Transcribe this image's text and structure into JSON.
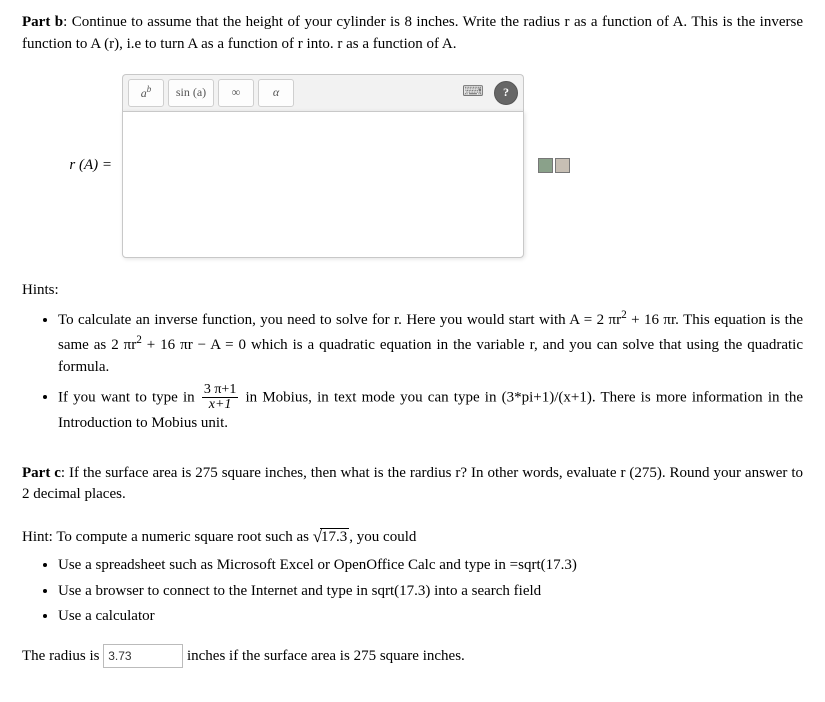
{
  "partB": {
    "title": "Part b",
    "text": ": Continue to assume that the height of your cylinder is 8 inches. Write the radius r as a function of A. This is the inverse function to A (r), i.e to turn A as a function of r into. r as a function of A.",
    "label_rA": "r (A) =",
    "toolbar": {
      "ab": "a",
      "ab_sup": "b",
      "sin": "sin (a)",
      "inf": "∞",
      "alpha": "α",
      "keyboard": "⌨",
      "help": "?"
    }
  },
  "hints": {
    "header": "Hints:",
    "item1_pre": "To calculate an inverse function, you need to solve for r. Here you would start with A = 2 πr",
    "item1_mid": " + 16 πr. This equation is the same as 2 πr",
    "item1_post": " + 16 πr − A = 0 which is a quadratic equation in the variable r, and you can solve that using the quadratic formula.",
    "item2_pre": "If you want to type in ",
    "frac_num": "3 π+1",
    "frac_den": "x+1",
    "item2_post": " in Mobius, in text mode you can type in (3*pi+1)/(x+1). There is more information in the Introduction to Mobius unit."
  },
  "partC": {
    "title": "Part c",
    "text": ": If the surface area is 275 square inches, then what is the rardius r? In other words, evaluate r (275). Round your answer to 2 decimal places.",
    "hint_pre": "Hint: To compute a numeric square root such as ",
    "sqrt_val": "17.3",
    "hint_post": ", you could",
    "bullets": [
      "Use a spreadsheet such as Microsoft Excel or OpenOffice Calc and type in =sqrt(17.3)",
      "Use a browser to connect to the Internet and type in sqrt(17.3) into a search field",
      "Use a calculator"
    ],
    "answer_pre": "The radius is ",
    "answer_value": "3.73",
    "answer_post": " inches if the surface area is 275 square inches."
  }
}
